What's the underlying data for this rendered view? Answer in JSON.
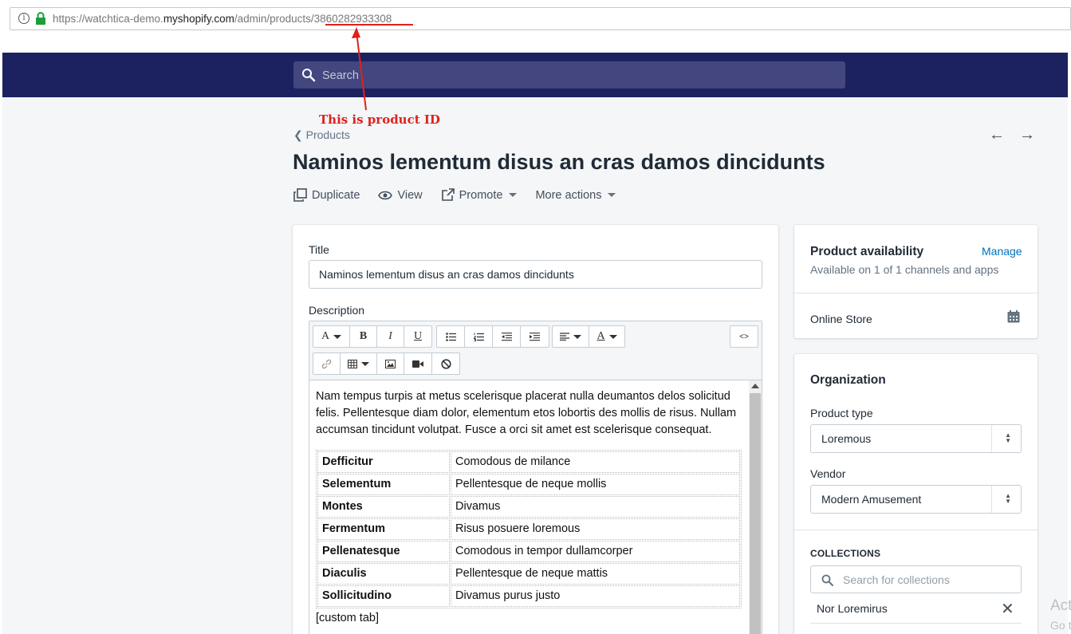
{
  "browser": {
    "url_prefix": "https://watchtica-demo.",
    "url_host": "myshopify.com",
    "url_path": "/admin/products/",
    "product_id": "3860282933308"
  },
  "annotation": {
    "label": "This is product ID",
    "color": "#e0211c"
  },
  "topbar": {
    "search_placeholder": "Search",
    "color": "#1c2260"
  },
  "header": {
    "breadcrumb": "Products",
    "title": "Naminos lementum disus an cras damos dincidunts",
    "actions": {
      "duplicate": "Duplicate",
      "view": "View",
      "promote": "Promote",
      "more_actions": "More actions"
    }
  },
  "product_form": {
    "title_label": "Title",
    "title_value": "Naminos lementum disus an cras damos dincidunts",
    "description_label": "Description",
    "toolbar": {
      "font_label": "A",
      "bold_label": "B",
      "italic_label": "I",
      "underline_label": "U",
      "font_color_label": "A",
      "code_view_label": "<>"
    },
    "description_paragraph": "Nam tempus turpis at metus scelerisque placerat nulla deumantos delos solicitud felis. Pellentesque diam dolor, elementum etos lobortis des mollis de risus. Nullam accumsan tincidunt volutpat. Fusce a orci sit amet est scelerisque consequat.",
    "spec_rows": [
      {
        "key": "Defficitur",
        "value": "Comodous de milance"
      },
      {
        "key": "Selementum",
        "value": "Pellentesque de neque mollis"
      },
      {
        "key": "Montes",
        "value": "Divamus"
      },
      {
        "key": "Fermentum",
        "value": "Risus posuere loremous"
      },
      {
        "key": "Pellenatesque",
        "value": "Comodous in tempor dullamcorper"
      },
      {
        "key": "Diaculis",
        "value": "Pellentesque de neque mattis"
      },
      {
        "key": "Sollicitudino",
        "value": "Divamus purus justo"
      }
    ],
    "custom_tab": "[custom tab]"
  },
  "availability": {
    "title": "Product availability",
    "manage_label": "Manage",
    "subtitle": "Available on 1 of 1 channels and apps",
    "channel": "Online Store"
  },
  "organization": {
    "title": "Organization",
    "product_type_label": "Product type",
    "product_type_value": "Loremous",
    "vendor_label": "Vendor",
    "vendor_value": "Modern Amusement",
    "collections_label": "COLLECTIONS",
    "collections_placeholder": "Search for collections",
    "collections": [
      "Nor Loremirus"
    ]
  },
  "os_watermark": {
    "line1": "Act",
    "line2": "Go t"
  }
}
